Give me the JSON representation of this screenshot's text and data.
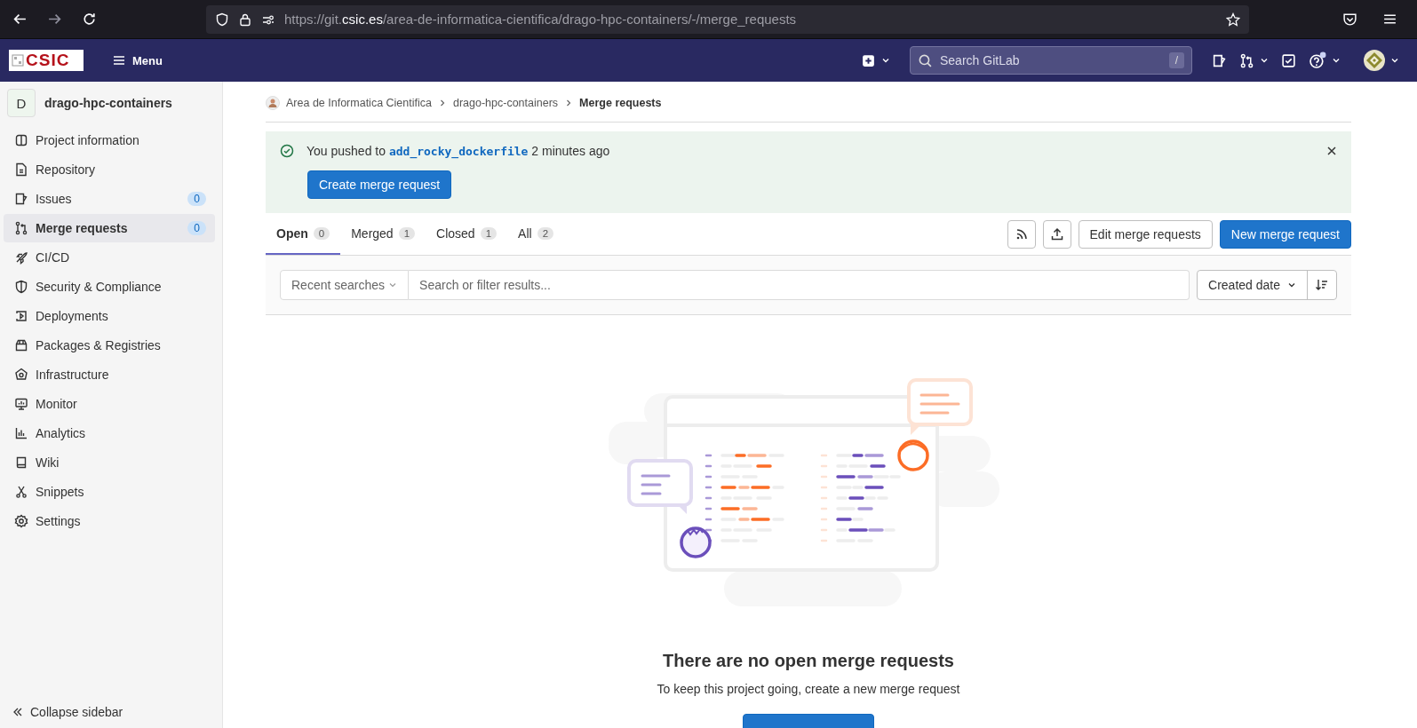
{
  "browser": {
    "url_prefix": "https://git.",
    "url_domain": "csic.es",
    "url_path": "/area-de-informatica-cientifica/drago-hpc-containers/-/merge_requests"
  },
  "header": {
    "logo": "CSIC",
    "menu": "Menu",
    "search_placeholder": "Search GitLab",
    "search_shortcut": "/"
  },
  "sidebar": {
    "project_avatar": "D",
    "project_name": "drago-hpc-containers",
    "items": [
      {
        "label": "Project information",
        "selected": false
      },
      {
        "label": "Repository",
        "selected": false
      },
      {
        "label": "Issues",
        "count": "0",
        "selected": false
      },
      {
        "label": "Merge requests",
        "count": "0",
        "selected": true
      },
      {
        "label": "CI/CD",
        "selected": false
      },
      {
        "label": "Security & Compliance",
        "selected": false
      },
      {
        "label": "Deployments",
        "selected": false
      },
      {
        "label": "Packages & Registries",
        "selected": false
      },
      {
        "label": "Infrastructure",
        "selected": false
      },
      {
        "label": "Monitor",
        "selected": false
      },
      {
        "label": "Analytics",
        "selected": false
      },
      {
        "label": "Wiki",
        "selected": false
      },
      {
        "label": "Snippets",
        "selected": false
      },
      {
        "label": "Settings",
        "selected": false
      }
    ],
    "collapse": "Collapse sidebar"
  },
  "breadcrumbs": [
    {
      "label": "Area de Informatica Cientifica",
      "current": false
    },
    {
      "label": "drago-hpc-containers",
      "current": false
    },
    {
      "label": "Merge requests",
      "current": true
    }
  ],
  "alert": {
    "prefix": "You pushed to",
    "branch": "add_rocky_dockerfile",
    "suffix": "2 minutes ago",
    "button": "Create merge request"
  },
  "tabs": [
    {
      "label": "Open",
      "count": "0",
      "selected": true
    },
    {
      "label": "Merged",
      "count": "1",
      "selected": false
    },
    {
      "label": "Closed",
      "count": "1",
      "selected": false
    },
    {
      "label": "All",
      "count": "2",
      "selected": false
    }
  ],
  "actions": [
    {
      "label": "Edit merge requests",
      "kind": "default"
    },
    {
      "label": "New merge request",
      "kind": "primary"
    }
  ],
  "filter": {
    "recent": "Recent searches",
    "placeholder": "Search or filter results...",
    "sort": "Created date"
  },
  "empty_state": {
    "title": "There are no open merge requests",
    "text": "To keep this project going, create a new merge request"
  }
}
